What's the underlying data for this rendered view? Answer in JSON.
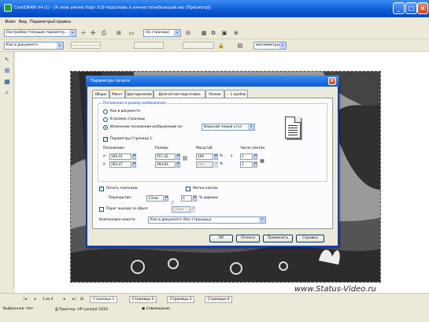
{
  "window": {
    "title": "CorelDRAW X4 (1) - [Я свою умняю Корп Х19 подсоловь в личности/небольшой вас (Просмотр)]",
    "controls": [
      "minimize-icon",
      "maximize-icon",
      "close-icon"
    ]
  },
  "menu": [
    "Файл",
    "Вид",
    "Параметры",
    "Справка"
  ],
  "toolbar1": {
    "preset": "Настройки (текущие параметр...",
    "page_select": "На странице",
    "icons": [
      "add-icon",
      "move-icon",
      "print-icon",
      "zoom-icon",
      "rotate-icon",
      "grid-icon",
      "mirror-icon",
      "properties-icon"
    ]
  },
  "toolbar2": {
    "position_mode": "Как в документе",
    "units": "миллиметры"
  },
  "watermark": "www.Status-Video.ru",
  "dialog": {
    "title": "Параметры печати",
    "tabs": [
      "Общие",
      "Макет",
      "Цветоделение",
      "Допечатная подготовка",
      "Разное",
      "1 пробле"
    ],
    "group_title": "Положение и размер изображения",
    "radios": {
      "as_doc": "Как в документе",
      "fit_page": "В размер страницы",
      "reposition": "Изменение положения изображений на:"
    },
    "reposition_value": "Верхний левый угол",
    "page_params": "Параметры Страница 1:",
    "headers": {
      "position": "Положение:",
      "size": "Размер:",
      "scale": "Масштаб:",
      "tiles": "Число плиток:"
    },
    "pos_x": "195,41",
    "pos_y": "265,47",
    "size_w": "557,42",
    "size_h": "394,83",
    "scale_a": "100",
    "scale_b": "100",
    "tiles_a": "1",
    "tiles_b": "1",
    "x_prefix": "x:",
    "y_prefix": "y:",
    "unit_pct": "%",
    "unit_x": "x",
    "print_tiles": "Печать плитками",
    "tile_marks": "Метки плиток",
    "overlap_label": "Перекрытие:",
    "overlap_value": "3,5мм",
    "overlap_pct": "0",
    "overlap_pct_label": "% ширины",
    "bleed_limit": "Порог выхода за обрез:",
    "bleed_value": "3,0мм",
    "imposition_label": "Компоновка макета:",
    "imposition_value": "Как в документе (без страницы)",
    "buttons": {
      "ok": "ОК",
      "cancel": "Отмена",
      "apply": "Применить",
      "help": "Справка"
    }
  },
  "page_nav": {
    "counter": "1 из 4",
    "pages": [
      "Страница 1",
      "Страница 2",
      "Страница 3",
      "Страница 4"
    ]
  },
  "status": {
    "selected": "Выбранное: Нет",
    "printer_label": "Принтер: HP LaserJet 1010",
    "composite": "Совмещение"
  }
}
